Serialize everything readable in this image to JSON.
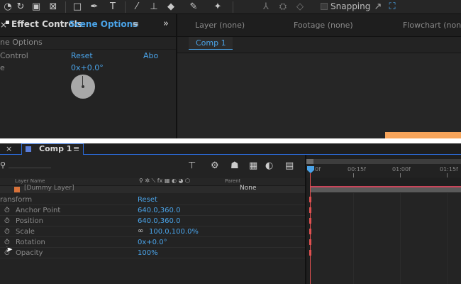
{
  "toolbar": {
    "snapping_label": "Snapping",
    "tools": [
      "zoom-tool-icon",
      "rotate-tool-icon",
      "camera-tool-icon",
      "pan-behind-tool-icon",
      "rectangle-tool-icon",
      "pen-tool-icon",
      "type-tool-icon",
      "brush-tool-icon",
      "clone-stamp-tool-icon",
      "eraser-tool-icon",
      "roto-brush-tool-icon",
      "puppet-tool-icon"
    ]
  },
  "effect_controls": {
    "tab_title": "Effect Controls",
    "tab_subject": "Scene Options",
    "menu_glyph": "≡",
    "subtitle": "ne Options",
    "row_header": {
      "col1": "Control",
      "col2": "Reset",
      "col3": "Abo"
    },
    "rotation_row": {
      "label": "e",
      "value": "0x+0.0°"
    }
  },
  "viewer": {
    "tabs": [
      "Layer (none)",
      "Footage (none)",
      "Flowchart (none"
    ],
    "comp_button": "Comp 1",
    "expand_glyph": "»"
  },
  "timeline": {
    "tab_label": "Comp 1",
    "tab_close": "×",
    "menu_glyph": "≡",
    "search_glyph": "⚲",
    "columns": {
      "layer_name": "Layer Name",
      "parent": "Parent"
    },
    "layer": {
      "name": "[Dummy Layer]",
      "parent": "None"
    },
    "transform_label": "ransform",
    "transform_reset": "Reset",
    "properties": [
      {
        "label": "Anchor Point",
        "value": "640.0,360.0"
      },
      {
        "label": "Position",
        "value": "640.0,360.0"
      },
      {
        "label": "Scale",
        "value": "100.0,100.0%"
      },
      {
        "label": "Rotation",
        "value": "0x+0.0°"
      },
      {
        "label": "Opacity",
        "value": "100%"
      }
    ],
    "scale_link_glyph": "∞",
    "ruler": [
      "0f",
      "00:15f",
      "01:00f",
      "01:15f"
    ]
  }
}
